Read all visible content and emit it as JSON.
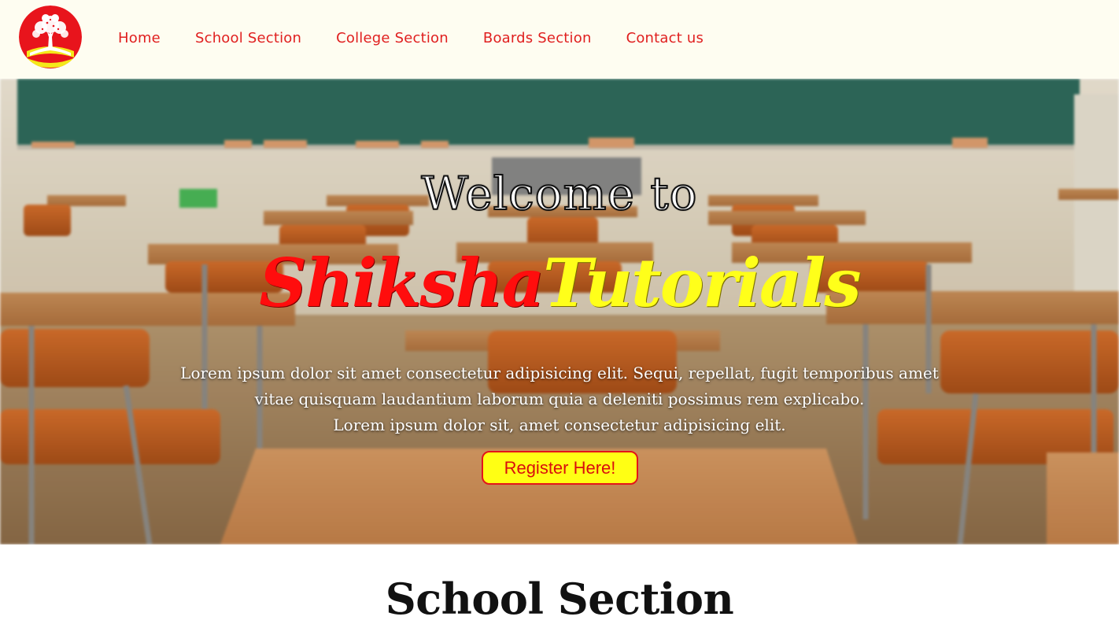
{
  "nav": {
    "items": [
      {
        "label": "Home"
      },
      {
        "label": "School Section"
      },
      {
        "label": "College Section"
      },
      {
        "label": "Boards Section"
      },
      {
        "label": "Contact us"
      }
    ]
  },
  "hero": {
    "welcome": "Welcome to",
    "brand_part1": "Shiksha",
    "brand_part2": "Tutorials",
    "tagline_line1": "Lorem ipsum dolor sit amet consectetur adipisicing elit. Sequi, repellat, fugit temporibus amet",
    "tagline_line2": "vitae quisquam laudantium laborum quia a deleniti possimus rem explicabo.",
    "tagline_line3": "Lorem ipsum dolor sit, amet consectetur adipisicing elit.",
    "register_label": "Register Here!"
  },
  "section": {
    "title": "School Section"
  },
  "colors": {
    "nav_bg": "#fefdf1",
    "nav_link": "#e01f1f",
    "brand_red": "#ff0d0d",
    "brand_yellow": "#ffff1a",
    "button_bg": "#ffff14",
    "button_border": "#e3141a"
  },
  "icons": {
    "logo": "tree-book-logo-icon"
  }
}
